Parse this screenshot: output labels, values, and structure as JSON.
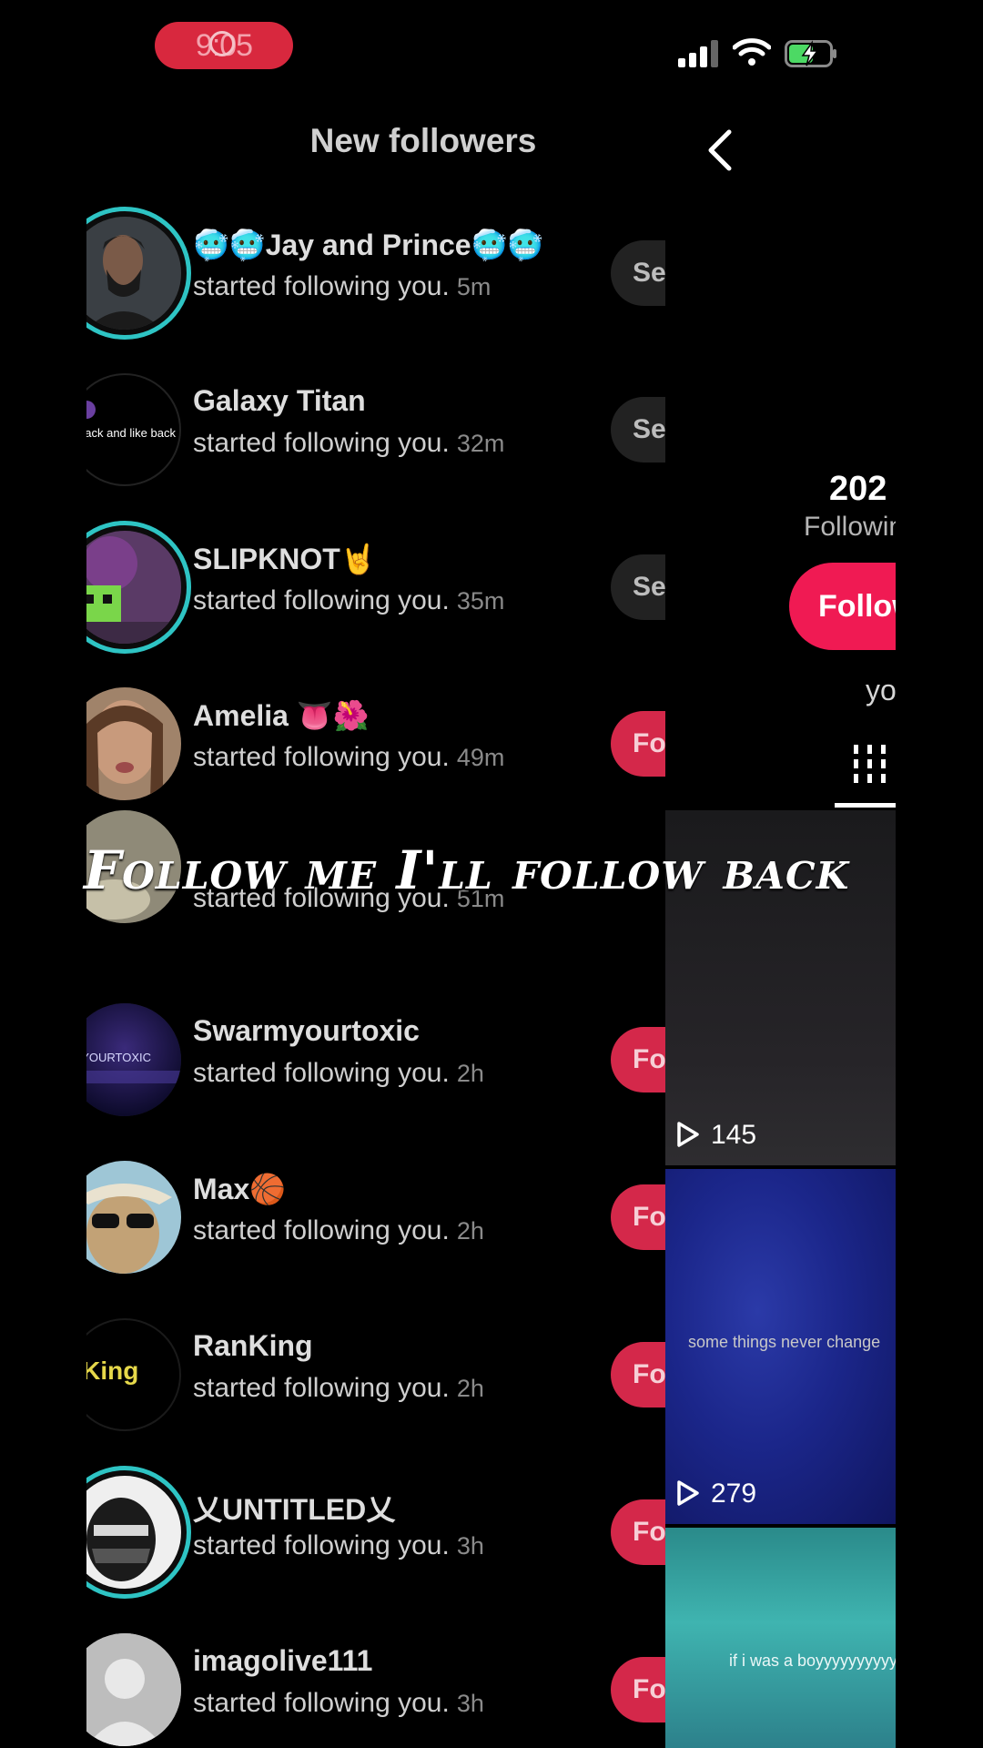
{
  "status_bar": {
    "time": "9:05"
  },
  "header": {
    "title": "New followers"
  },
  "followers": [
    {
      "name": "🥶🥶Jay and Prince🥶🥶",
      "action": "started following you.",
      "time": "5m",
      "button": "See",
      "button_type": "see",
      "avatar_text": "",
      "ring": true
    },
    {
      "name": "Galaxy Titan",
      "action": "started following you.",
      "time": "32m",
      "button": "See",
      "button_type": "see",
      "avatar_text": "w back and like back",
      "ring": false
    },
    {
      "name": "SLIPKNOT🤘",
      "action": "started following you.",
      "time": "35m",
      "button": "See",
      "button_type": "see",
      "avatar_text": "",
      "ring": true
    },
    {
      "name": "Amelia 👅🌺",
      "action": "started following you.",
      "time": "49m",
      "button": "Follow",
      "button_type": "follow",
      "avatar_text": "",
      "ring": false
    },
    {
      "name": "",
      "action": "started following you.",
      "time": "51m",
      "button": "",
      "button_type": "see",
      "avatar_text": "",
      "ring": false
    },
    {
      "name": "Swarmyourtoxic",
      "action": "started following you.",
      "time": "2h",
      "button": "Follow",
      "button_type": "follow",
      "avatar_text": "RMYOURTOXIC",
      "ring": false
    },
    {
      "name": "Max🏀",
      "action": "started following you.",
      "time": "2h",
      "button": "Follow",
      "button_type": "follow",
      "avatar_text": "",
      "ring": false
    },
    {
      "name": "RanKing",
      "action": "started following you.",
      "time": "2h",
      "button": "Follow",
      "button_type": "follow",
      "avatar_text": "nKing",
      "ring": false
    },
    {
      "name": "乂UNTITLED乂",
      "action": "started following you.",
      "time": "3h",
      "button": "Follow",
      "button_type": "follow",
      "avatar_text": "",
      "ring": true
    },
    {
      "name": "imagolive111",
      "action": "started following you.",
      "time": "3h",
      "button": "Follow",
      "button_type": "follow",
      "avatar_text": "",
      "ring": false
    }
  ],
  "caption": "Follow me I'll follow back",
  "profile": {
    "stat_number": "202",
    "stat_label": "Following",
    "follow_button": "Follow",
    "bio_fragment": "yo",
    "videos": [
      {
        "views": "145",
        "overlay_text": ""
      },
      {
        "views": "279",
        "overlay_text": "some things never change"
      },
      {
        "views": "",
        "overlay_text": "if i was a boyyyyyyyyyy"
      }
    ]
  }
}
